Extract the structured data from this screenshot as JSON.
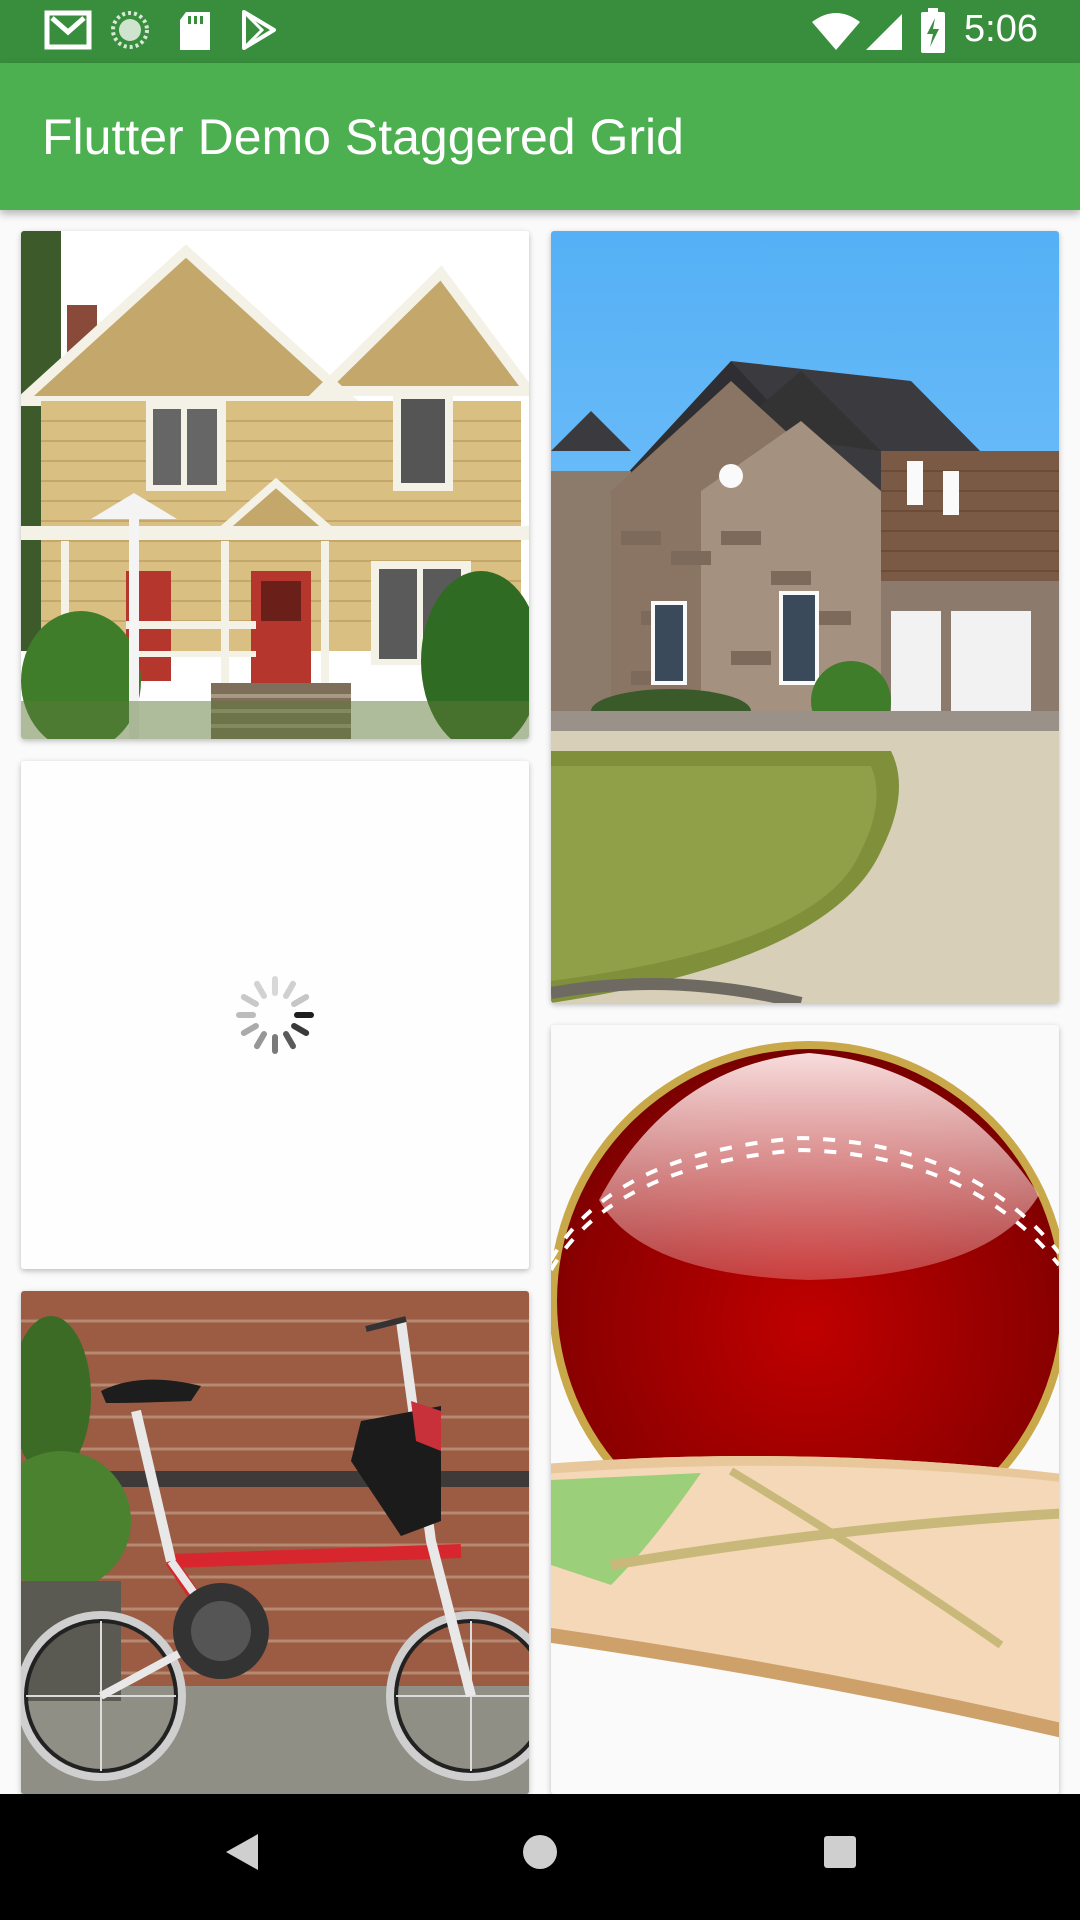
{
  "status_bar": {
    "time": "5:06",
    "icons_left": [
      "gmail-icon",
      "sync-icon",
      "sd-card-icon",
      "play-store-icon"
    ],
    "icons_right": [
      "wifi-icon",
      "signal-icon",
      "battery-charging-icon"
    ]
  },
  "app_bar": {
    "title": "Flutter Demo Staggered Grid",
    "background_color": "#4caf50",
    "status_bar_color": "#388e3c"
  },
  "grid": {
    "tiles": [
      {
        "id": "yellow-victorian-house-image",
        "column": "left",
        "state": "loaded"
      },
      {
        "id": "loading-tile",
        "column": "left",
        "state": "loading"
      },
      {
        "id": "red-bicycle-image",
        "column": "left",
        "state": "loaded"
      },
      {
        "id": "stone-house-image",
        "column": "right",
        "state": "loaded"
      },
      {
        "id": "cricket-ball-image",
        "column": "right",
        "state": "loaded"
      }
    ]
  },
  "nav_bar": {
    "buttons": [
      "back-button",
      "home-button",
      "recents-button"
    ]
  }
}
